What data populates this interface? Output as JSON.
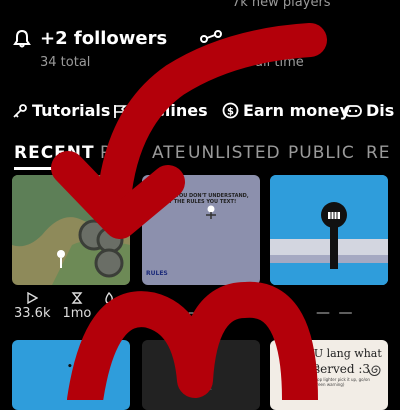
{
  "top_partial": "7k new players",
  "stats": {
    "followers_main": "+2 followers",
    "followers_sub": "34 total",
    "players_main": "s",
    "players_sub": "1/1 all time"
  },
  "chips": [
    {
      "label": "Tutorials"
    },
    {
      "label": "elines"
    },
    {
      "label": "Earn money"
    },
    {
      "label": "Dis"
    }
  ],
  "tabs": [
    {
      "label": "RECENT"
    },
    {
      "label": "PR"
    },
    {
      "label": "ATE"
    },
    {
      "label": "UNLISTED"
    },
    {
      "label": "PUBLIC"
    },
    {
      "label": "RE"
    }
  ],
  "cards": {
    "c1": {
      "views": "33.6k",
      "time": "1mo"
    },
    "c2": {
      "dashes": "— —",
      "caption_top": "REATTOR YOU DON'T UNDERSTAND, LOOK AT THE RULES YOU TEXT!",
      "caption_bottom": "RULES"
    },
    "c3": {
      "dashes": "— —"
    },
    "c6": {
      "text_line1": "KU lang what he",
      "text_line2": "served :3",
      "small": "(top lighter pick it up, go/on green warning)"
    }
  },
  "colors": {
    "background": "#000000",
    "muted": "#9a9a9a",
    "arrow_red": "#b3000a"
  }
}
